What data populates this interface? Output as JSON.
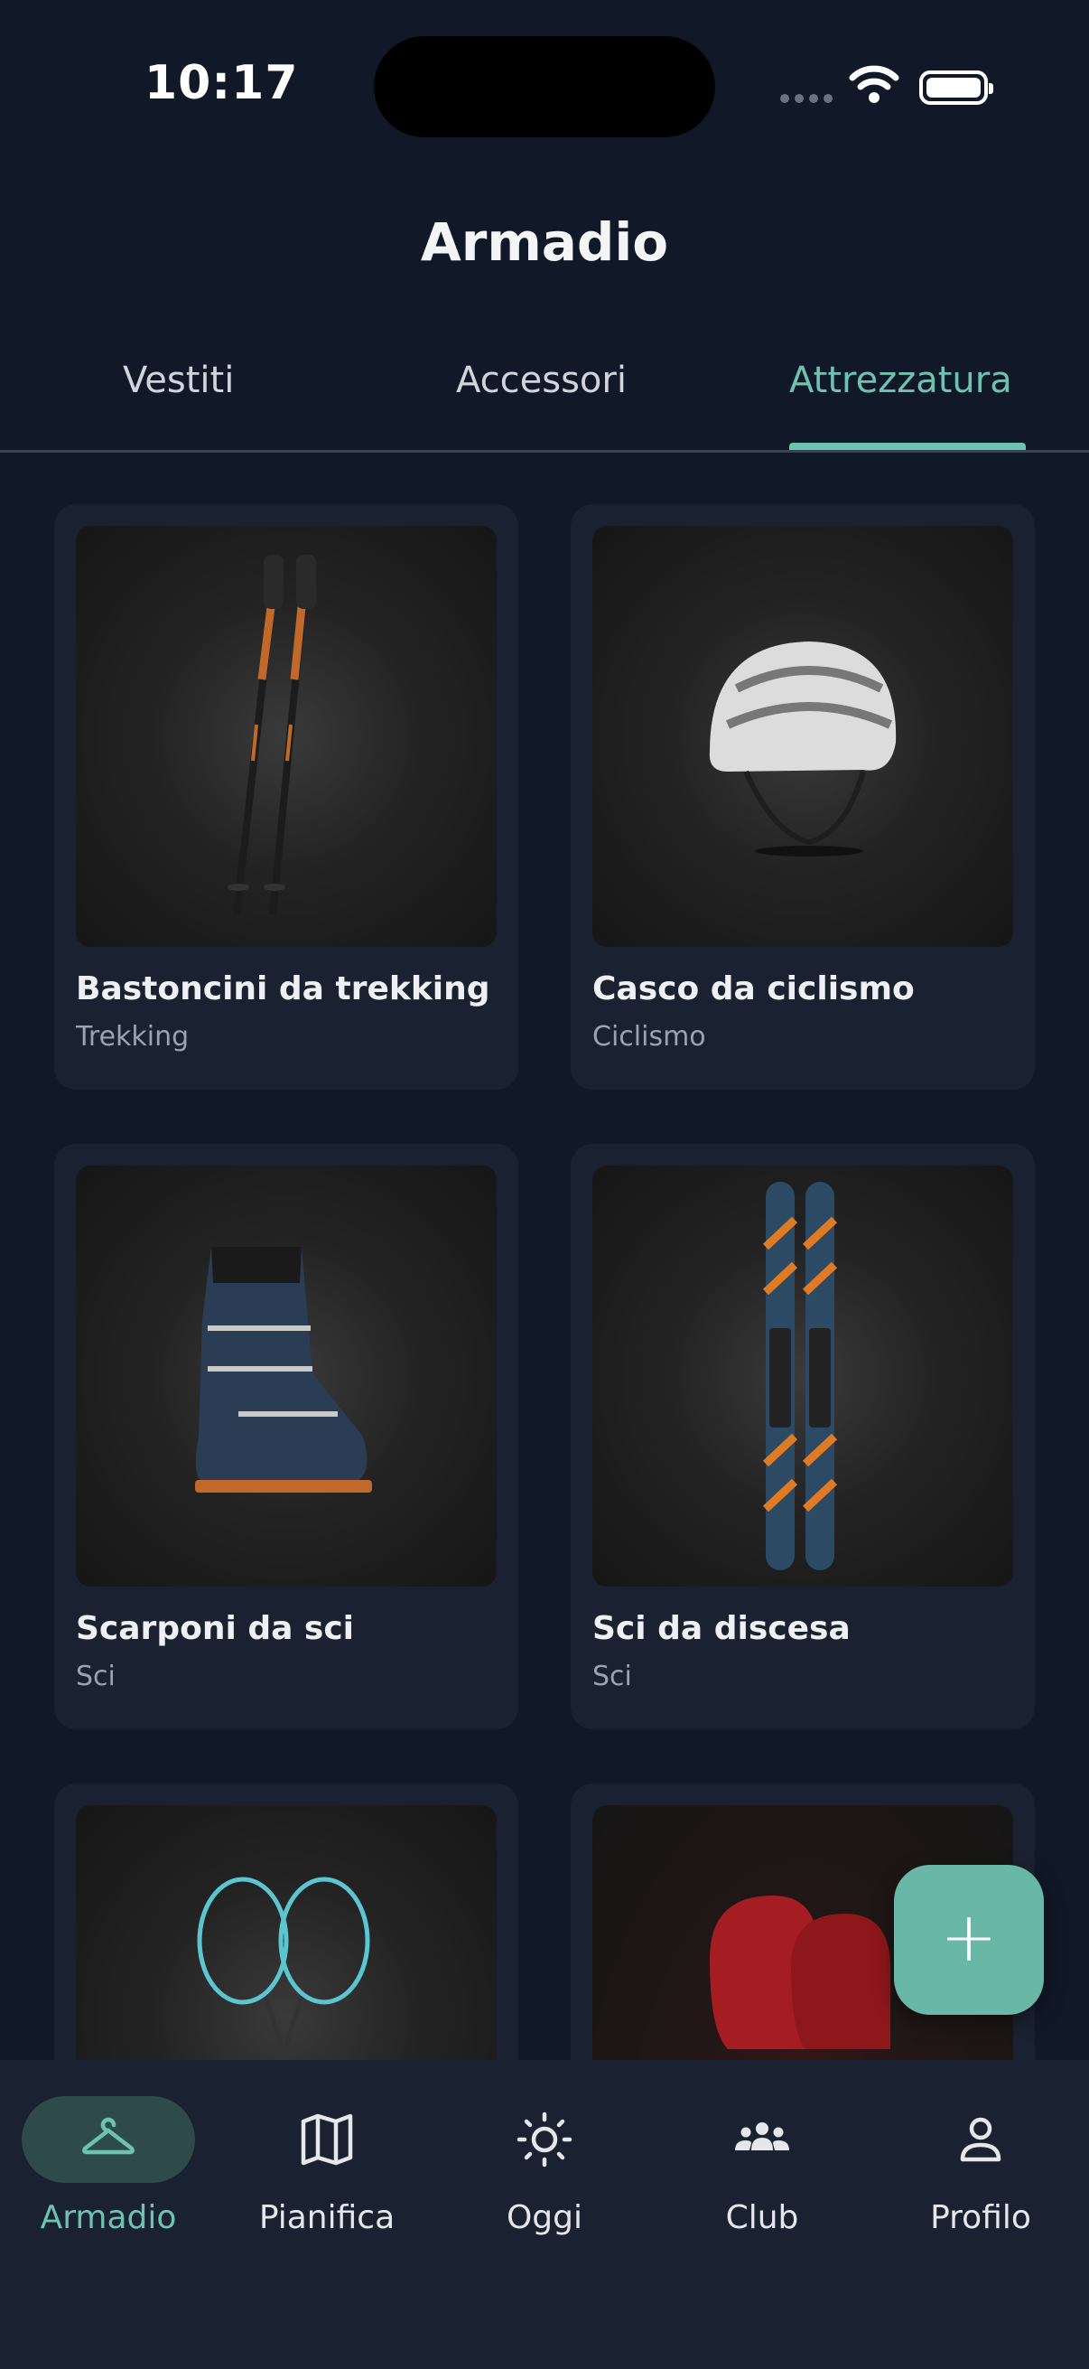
{
  "status": {
    "time": "10:17"
  },
  "header": {
    "title": "Armadio"
  },
  "tabs": [
    {
      "label": "Vestiti"
    },
    {
      "label": "Accessori"
    },
    {
      "label": "Attrezzatura",
      "active": true
    }
  ],
  "items": [
    {
      "name": "Bastoncini da trekking",
      "category": "Trekking",
      "icon": "trekking-poles"
    },
    {
      "name": "Casco da ciclismo",
      "category": "Ciclismo",
      "icon": "bike-helmet"
    },
    {
      "name": "Scarponi da sci",
      "category": "Sci",
      "icon": "ski-boot"
    },
    {
      "name": "Sci da discesa",
      "category": "Sci",
      "icon": "skis"
    },
    {
      "name": "",
      "category": "",
      "icon": "badminton-rackets"
    },
    {
      "name": "",
      "category": "",
      "icon": "boxing-gloves"
    }
  ],
  "fab": {
    "label": "+"
  },
  "nav": [
    {
      "label": "Armadio",
      "icon": "hanger-icon",
      "active": true
    },
    {
      "label": "Pianifica",
      "icon": "map-icon"
    },
    {
      "label": "Oggi",
      "icon": "sun-icon"
    },
    {
      "label": "Club",
      "icon": "group-icon"
    },
    {
      "label": "Profilo",
      "icon": "person-icon"
    }
  ],
  "colors": {
    "background": "#111827",
    "card": "#1a2130",
    "accent": "#6ec2b0",
    "fab": "#69b7a6"
  }
}
